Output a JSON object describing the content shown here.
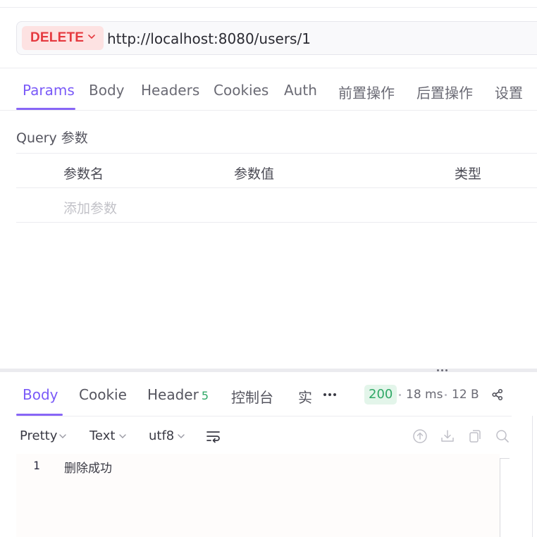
{
  "request": {
    "method": "DELETE",
    "url": "http://localhost:8080/users/1"
  },
  "request_tabs": [
    "Params",
    "Body",
    "Headers",
    "Cookies",
    "Auth",
    "前置操作",
    "后置操作",
    "设置"
  ],
  "params": {
    "section_title": "Query 参数",
    "columns": [
      "参数名",
      "参数值",
      "类型"
    ],
    "add_placeholder": "添加参数"
  },
  "response": {
    "tabs": {
      "body": "Body",
      "cookie": "Cookie",
      "header": "Header",
      "header_count": "5",
      "console": "控制台",
      "realtime": "实"
    },
    "status_code": "200",
    "time": "18 ms",
    "size": "12 B",
    "toolbar": {
      "format": "Pretty",
      "type": "Text",
      "encoding": "utf8"
    },
    "body_lines": [
      {
        "number": "1",
        "text": "删除成功"
      }
    ]
  },
  "colors": {
    "accent": "#7a5af8",
    "method_delete": "#e5393f",
    "status_success": "#2fa866"
  },
  "icons": [
    "chevron-down-icon",
    "more-icon",
    "share-icon",
    "wrap-lines-icon",
    "upload-icon",
    "download-icon",
    "copy-icon",
    "search-icon",
    "drag-handle-icon"
  ]
}
